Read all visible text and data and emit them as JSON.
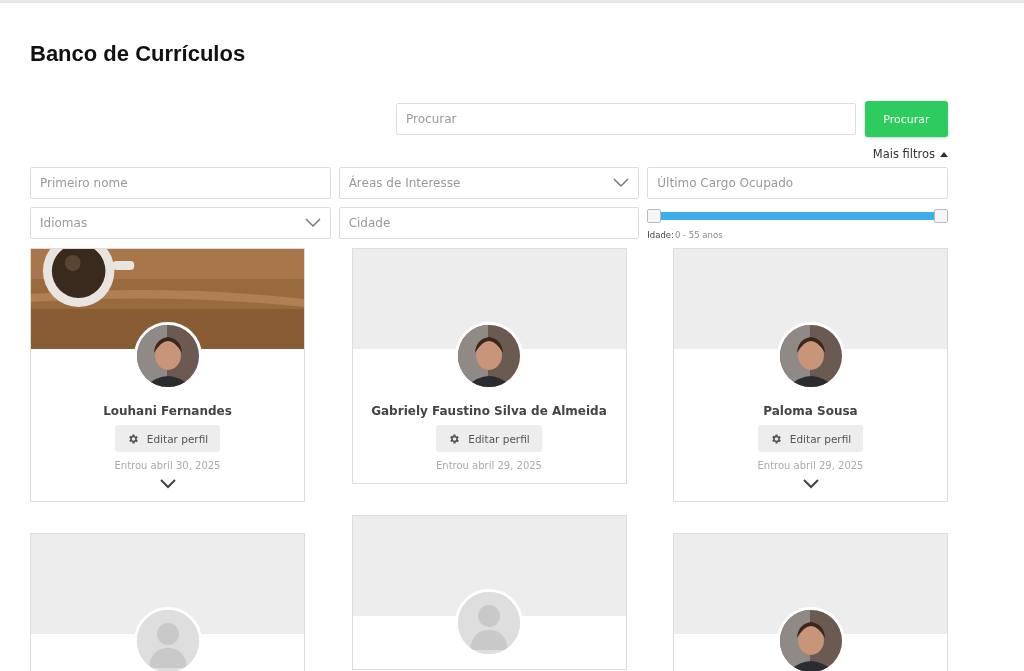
{
  "title": "Banco de Currículos",
  "search": {
    "placeholder": "Procurar",
    "button": "Procurar"
  },
  "more_filters": {
    "label": "Mais filtros",
    "expanded": true
  },
  "filters": [
    {
      "kind": "text",
      "placeholder": "Primeiro nome"
    },
    {
      "kind": "select",
      "placeholder": "Áreas de Interesse"
    },
    {
      "kind": "text",
      "placeholder": "Último Cargo Ocupado"
    },
    {
      "kind": "select",
      "placeholder": "Idiomas"
    },
    {
      "kind": "text",
      "placeholder": "Cidade"
    },
    {
      "kind": "range",
      "level": 1,
      "label": "Idade:",
      "reading": "0 - 55 anos"
    }
  ],
  "columns": [
    [
      {
        "name": "Louhani Fernandes",
        "button": "Editar perfil",
        "joined": "Entrou abril 30, 2025",
        "toggle": true
      },
      {
        "cover": {
          "kind": "empty"
        },
        "avatar": {
          "kind": "placeholder"
        }
      }
    ],
    [
      {
        "cover": {
          "kind": "empty"
        },
        "name": "Gabriely Faustino Silva de Almeida",
        "button": "Editar perfil",
        "joined": "Entrou abril 29, 2025",
        "toggle": false
      },
      {
        "cover": {
          "kind": "empty"
        },
        "avatar": {
          "kind": "placeholder"
        }
      }
    ],
    [
      {
        "cover": {
          "kind": "empty"
        },
        "name": "Paloma Sousa",
        "button": "Editar perfil",
        "joined": "Entrou abril 29, 2025",
        "toggle": true
      },
      {
        "cover": {
          "kind": "empty"
        }
      }
    ]
  ]
}
